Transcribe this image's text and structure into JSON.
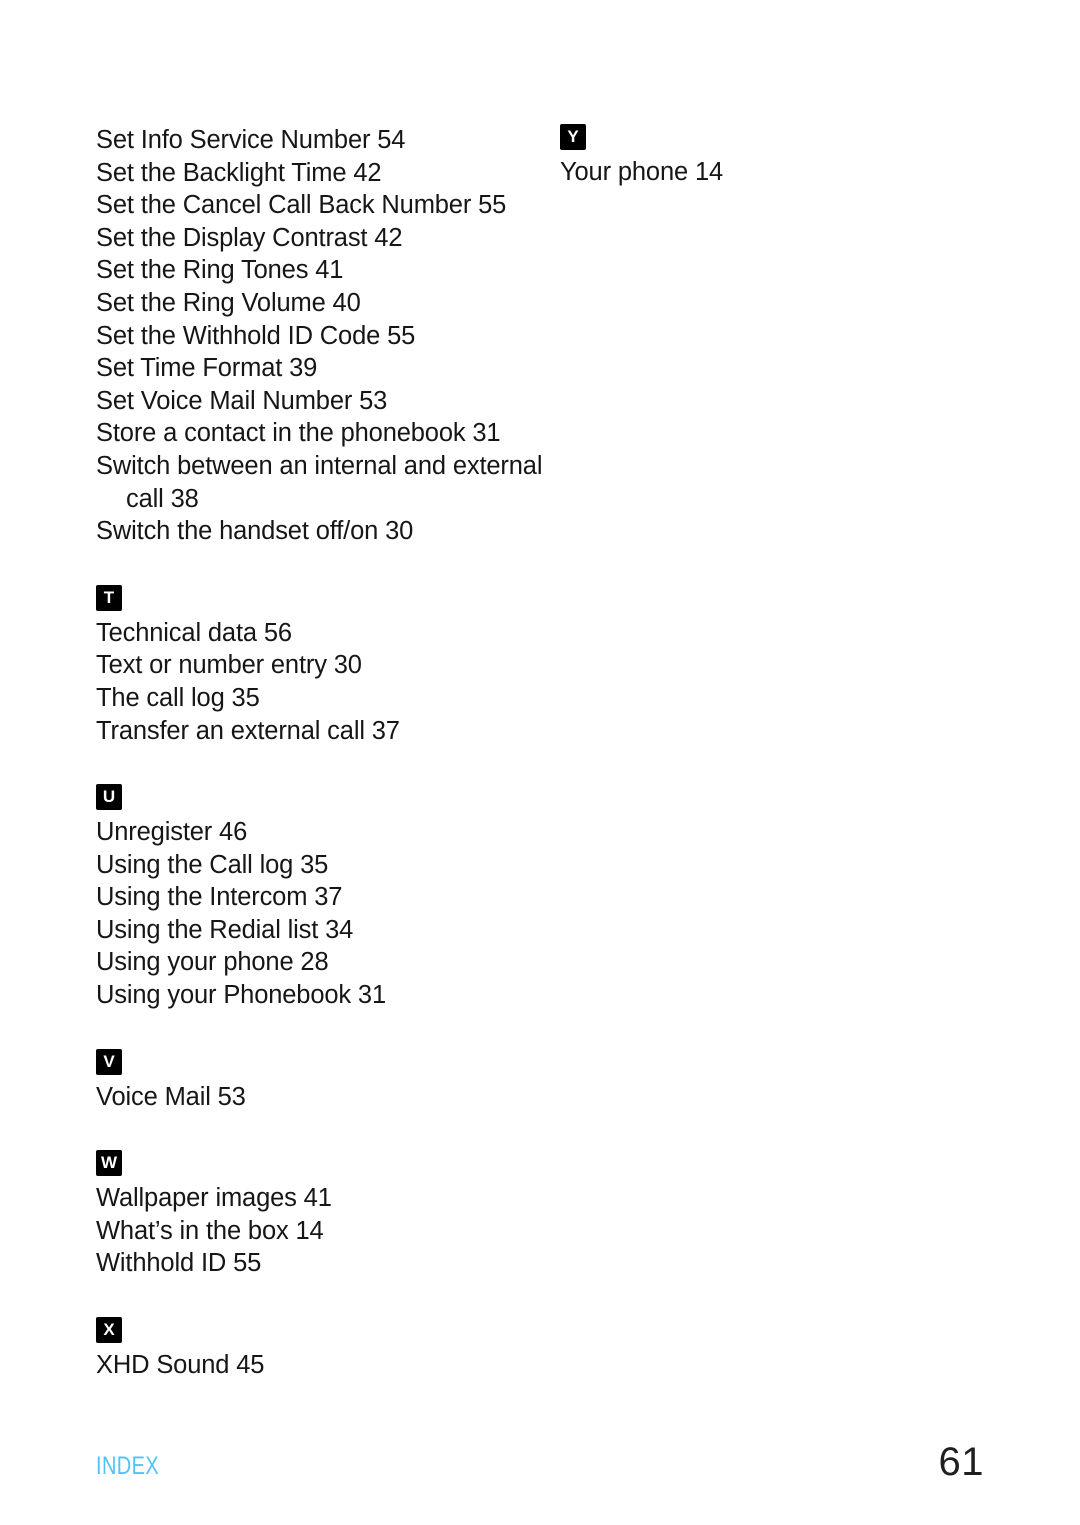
{
  "document": {
    "footer": {
      "label": "INDEX",
      "page_number": "61",
      "label_color": "#4FC3F7"
    }
  },
  "columns": {
    "left": {
      "sections": [
        {
          "letter": "",
          "entries": [
            {
              "text": "Set Info Service Number 54",
              "continuation": false
            },
            {
              "text": "Set the Backlight Time 42",
              "continuation": false
            },
            {
              "text": "Set the Cancel Call Back Number 55",
              "continuation": false
            },
            {
              "text": "Set the Display Contrast 42",
              "continuation": false
            },
            {
              "text": "Set the Ring Tones 41",
              "continuation": false
            },
            {
              "text": "Set the Ring Volume 40",
              "continuation": false
            },
            {
              "text": "Set the Withhold ID Code 55",
              "continuation": false
            },
            {
              "text": "Set Time Format 39",
              "continuation": false
            },
            {
              "text": "Set Voice Mail Number 53",
              "continuation": false
            },
            {
              "text": "Store a contact in the phonebook 31",
              "continuation": false
            },
            {
              "text": "Switch between an internal and external",
              "continuation": false
            },
            {
              "text": "call 38",
              "continuation": true
            },
            {
              "text": "Switch the handset off/on 30",
              "continuation": false
            }
          ]
        },
        {
          "letter": "T",
          "entries": [
            {
              "text": "Technical data 56",
              "continuation": false
            },
            {
              "text": "Text or number entry 30",
              "continuation": false
            },
            {
              "text": "The call log 35",
              "continuation": false
            },
            {
              "text": "Transfer an external call 37",
              "continuation": false
            }
          ]
        },
        {
          "letter": "U",
          "entries": [
            {
              "text": "Unregister 46",
              "continuation": false
            },
            {
              "text": "Using the Call log 35",
              "continuation": false
            },
            {
              "text": "Using the Intercom 37",
              "continuation": false
            },
            {
              "text": "Using the Redial list 34",
              "continuation": false
            },
            {
              "text": "Using your phone 28",
              "continuation": false
            },
            {
              "text": "Using your Phonebook 31",
              "continuation": false
            }
          ]
        },
        {
          "letter": "V",
          "entries": [
            {
              "text": "Voice Mail 53",
              "continuation": false
            }
          ]
        },
        {
          "letter": "W",
          "entries": [
            {
              "text": "Wallpaper images 41",
              "continuation": false
            },
            {
              "text": "What’s in the box 14",
              "continuation": false
            },
            {
              "text": "Withhold ID 55",
              "continuation": false
            }
          ]
        },
        {
          "letter": "X",
          "entries": [
            {
              "text": "XHD Sound 45",
              "continuation": false
            }
          ]
        }
      ]
    },
    "right": {
      "sections": [
        {
          "letter": "Y",
          "entries": [
            {
              "text": "Your phone 14",
              "continuation": false
            }
          ]
        }
      ]
    }
  }
}
